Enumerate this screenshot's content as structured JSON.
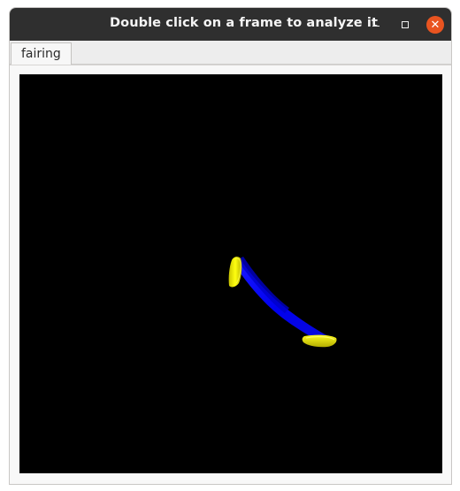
{
  "window": {
    "title": "Double click on a frame to analyze it",
    "controls": {
      "minimize_icon": "minimize-icon",
      "maximize_icon": "maximize-icon",
      "close_icon": "close-icon",
      "close_color": "#e95420"
    }
  },
  "tabs": [
    {
      "label": "fairing",
      "active": true
    }
  ],
  "viewport": {
    "background": "#000000",
    "object_colors": {
      "body": "#0a10ff",
      "caps": "#f0ec00"
    }
  }
}
